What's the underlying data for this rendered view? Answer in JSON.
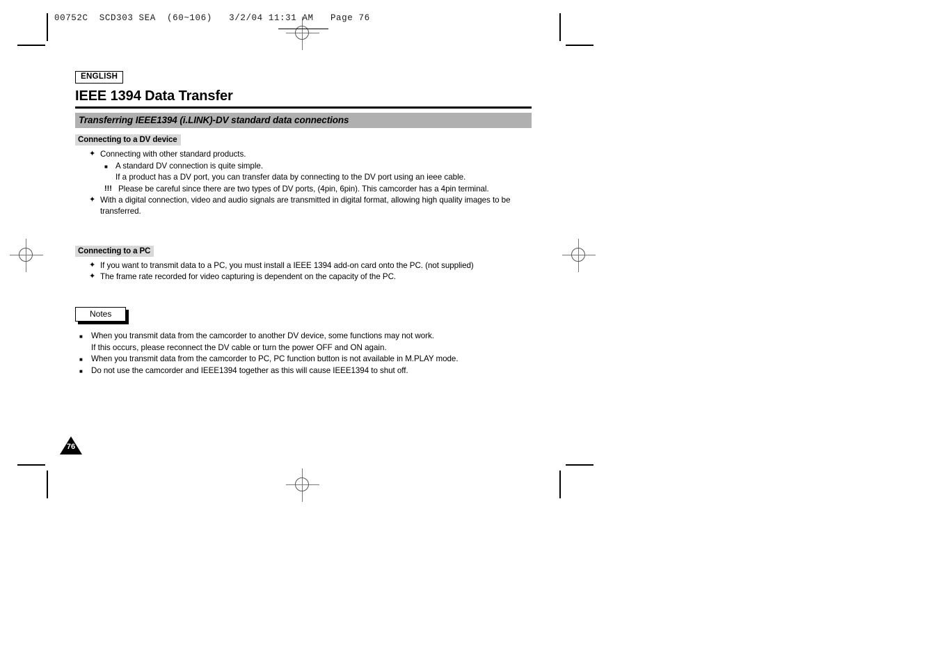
{
  "film_header": {
    "text": "00752C  SCD303 SEA  (60~106)   3/2/04 11:31 AM   Page 76"
  },
  "document": {
    "language_badge": "ENGLISH",
    "title": "IEEE 1394 Data Transfer",
    "section_bar": "Transferring IEEE1394 (i.LINK)-DV standard data connections",
    "page_number": "76"
  },
  "markers": {
    "flower": "✦",
    "square": "■",
    "bang": "!!!"
  },
  "dv_section": {
    "heading": "Connecting to a DV device",
    "items": [
      {
        "marker": "flower",
        "text": "Connecting with other standard products."
      },
      {
        "marker": "square",
        "text": "A standard DV connection is quite simple."
      },
      {
        "marker": "cont",
        "text": "If a product has a DV port, you can transfer data by connecting to the DV port using an ieee cable."
      },
      {
        "marker": "bang",
        "text": "Please be careful since there are two types of DV ports, (4pin, 6pin). This camcorder has a 4pin terminal."
      },
      {
        "marker": "flower",
        "text": "With a digital connection, video and audio signals are transmitted in digital format, allowing high quality images to be transferred."
      }
    ]
  },
  "pc_section": {
    "heading": "Connecting to a PC",
    "items": [
      {
        "marker": "flower",
        "text": "If you want to transmit data to a PC, you must install a IEEE 1394 add-on card onto the PC. (not supplied)"
      },
      {
        "marker": "flower",
        "text": "The frame rate recorded for video capturing is dependent on the capacity of the PC."
      }
    ]
  },
  "notes_section": {
    "label": "Notes",
    "items": [
      {
        "marker": "square",
        "text": "When you transmit data from the camcorder to another DV device, some functions may not work."
      },
      {
        "marker": "cont",
        "text": "If this occurs, please reconnect the DV cable or turn the power OFF and ON again."
      },
      {
        "marker": "square",
        "text": "When you transmit data from the camcorder to PC, PC function button is not available in M.PLAY mode."
      },
      {
        "marker": "square",
        "text": "Do not use the camcorder and IEEE1394 together as this will cause IEEE1394 to shut off."
      }
    ]
  },
  "colors": {
    "section_bar_bg": "#b0b0b0",
    "sub_head_bg": "#d8d8d8",
    "ink": "#000000"
  }
}
